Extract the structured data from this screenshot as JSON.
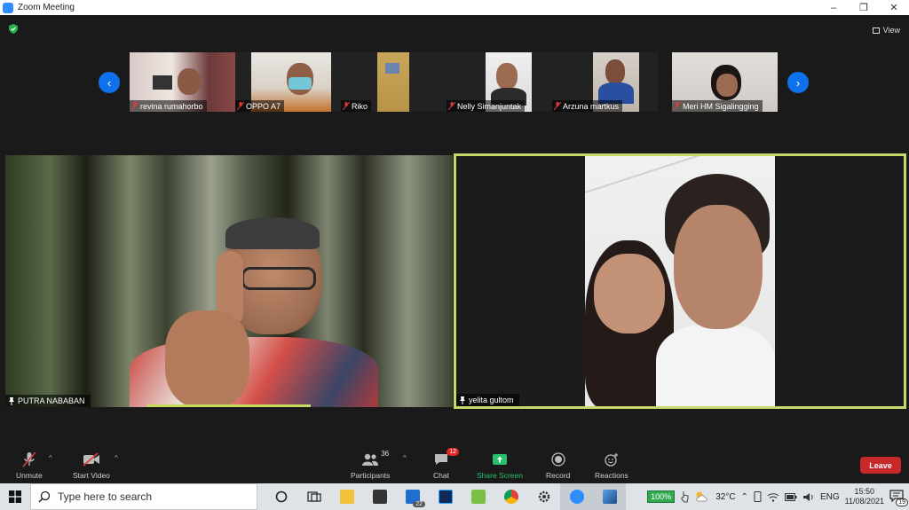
{
  "window": {
    "title": "Zoom Meeting",
    "minimize": "–",
    "maximize": "❐",
    "close": "✕"
  },
  "view_label": "View",
  "thumbnails": [
    {
      "name": "revina rumahorbo"
    },
    {
      "name": "OPPO A7"
    },
    {
      "name": "Riko"
    },
    {
      "name": "Nelly Simanjuntak"
    },
    {
      "name": "Arzuna martkus"
    },
    {
      "name": "Meri HM Sigalingging"
    }
  ],
  "nav": {
    "prev": "‹",
    "next": "›"
  },
  "main_videos": {
    "left": {
      "name": "PUTRA NABABAN"
    },
    "right": {
      "name": "yelita gultom"
    }
  },
  "toolbar": {
    "unmute": "Unmute",
    "start_video": "Start Video",
    "participants": "Participants",
    "participants_count": "36",
    "chat": "Chat",
    "chat_badge": "12",
    "share_screen": "Share Screen",
    "record": "Record",
    "reactions": "Reactions",
    "leave": "Leave",
    "caret": "^"
  },
  "taskbar": {
    "search_placeholder": "Type here to search",
    "mail_badge": "22",
    "battery": "100%",
    "temperature": "32°C",
    "language": "ENG",
    "time": "15:50",
    "date": "11/08/2021",
    "notifications": "19"
  },
  "colors": {
    "accent_blue": "#0e72ed",
    "active_speaker": "#c6d86a",
    "share_green": "#27c06b",
    "leave_red": "#c7282a",
    "badge_red": "#e02828"
  }
}
